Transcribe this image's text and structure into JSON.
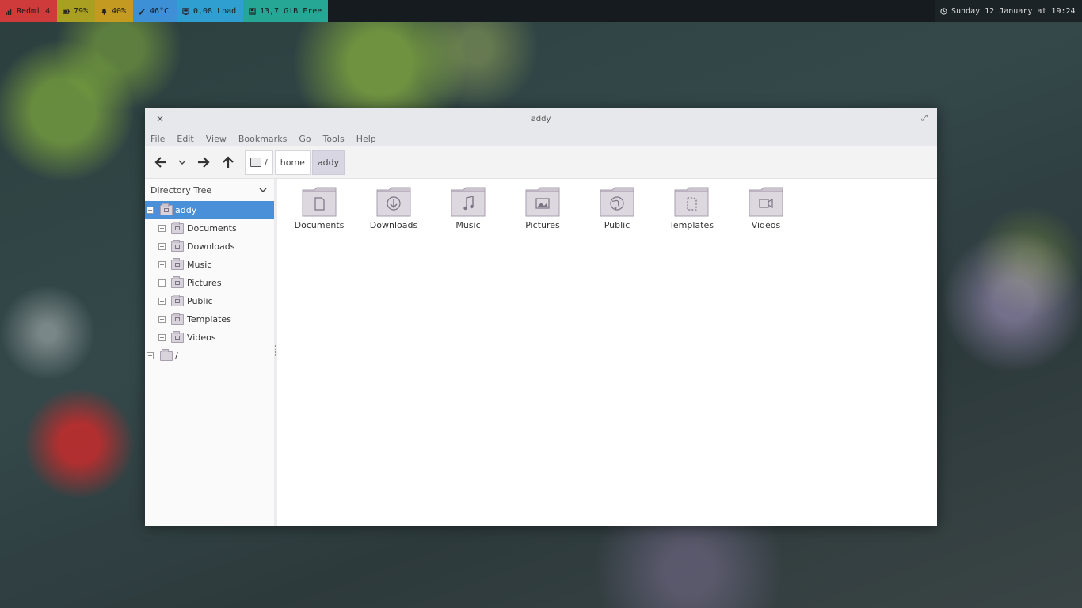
{
  "topbar": {
    "segments": [
      {
        "id": "wifi",
        "icon": "signal-icon",
        "text": "Redmi 4",
        "color": "#cf3b3b"
      },
      {
        "id": "battery",
        "icon": "battery-icon",
        "text": "79%",
        "color": "#a9a021"
      },
      {
        "id": "volume",
        "icon": "bell-icon",
        "text": "40%",
        "color": "#c49a21"
      },
      {
        "id": "temp",
        "icon": "thermometer-icon",
        "text": "46°C",
        "color": "#3d8fd6"
      },
      {
        "id": "load",
        "icon": "cpu-icon",
        "text": "0,08 Load",
        "color": "#2f9ed1"
      },
      {
        "id": "disk",
        "icon": "disk-icon",
        "text": "13,7 GiB Free",
        "color": "#26a796"
      }
    ],
    "clock": {
      "icon": "clock-icon",
      "text": "Sunday 12 January at 19:24"
    }
  },
  "window": {
    "title": "addy",
    "menu": [
      "File",
      "Edit",
      "View",
      "Bookmarks",
      "Go",
      "Tools",
      "Help"
    ],
    "path": [
      {
        "label": "/",
        "icon": "drive-icon"
      },
      {
        "label": "home"
      },
      {
        "label": "addy",
        "active": true
      }
    ],
    "sidebar": {
      "header": "Directory Tree",
      "root": {
        "label": "addy",
        "icon": "home-folder-icon",
        "expanded": true,
        "selected": true
      },
      "children": [
        {
          "label": "Documents",
          "icon": "documents-folder-icon"
        },
        {
          "label": "Downloads",
          "icon": "downloads-folder-icon"
        },
        {
          "label": "Music",
          "icon": "music-folder-icon"
        },
        {
          "label": "Pictures",
          "icon": "pictures-folder-icon"
        },
        {
          "label": "Public",
          "icon": "public-folder-icon"
        },
        {
          "label": "Templates",
          "icon": "templates-folder-icon"
        },
        {
          "label": "Videos",
          "icon": "videos-folder-icon"
        }
      ],
      "filesystem_root": {
        "label": "/",
        "icon": "folder-icon"
      }
    },
    "items": [
      {
        "label": "Documents",
        "icon": "documents-folder-icon"
      },
      {
        "label": "Downloads",
        "icon": "downloads-folder-icon"
      },
      {
        "label": "Music",
        "icon": "music-folder-icon"
      },
      {
        "label": "Pictures",
        "icon": "pictures-folder-icon"
      },
      {
        "label": "Public",
        "icon": "public-folder-icon"
      },
      {
        "label": "Templates",
        "icon": "templates-folder-icon"
      },
      {
        "label": "Videos",
        "icon": "videos-folder-icon"
      }
    ]
  },
  "colors": {
    "selection": "#4a90d9",
    "folder_fill": "#d9d3dc",
    "folder_stroke": "#a89fae"
  }
}
